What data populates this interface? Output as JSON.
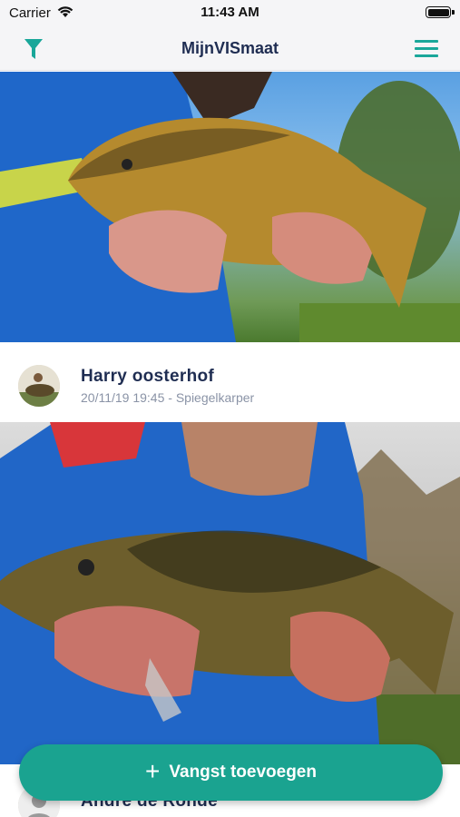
{
  "status_bar": {
    "carrier": "Carrier",
    "time": "11:43 AM"
  },
  "nav": {
    "title": "MijnVISmaat",
    "filter_icon": "filter-icon",
    "menu_icon": "hamburger-menu-icon"
  },
  "posts": [
    {
      "image": "photo-angler-holding-carp"
    },
    {
      "name": "Harry oosterhof",
      "meta": "20/11/19 19:45 - Spiegelkarper",
      "image": "photo-angler-holding-mirror-carp"
    },
    {
      "name": "Andre de Ronde"
    }
  ],
  "add_button": {
    "label": "Vangst toevoegen",
    "icon": "plus-icon"
  },
  "colors": {
    "accent": "#1aa390",
    "title": "#1f2d52",
    "meta": "#8a93a6"
  }
}
